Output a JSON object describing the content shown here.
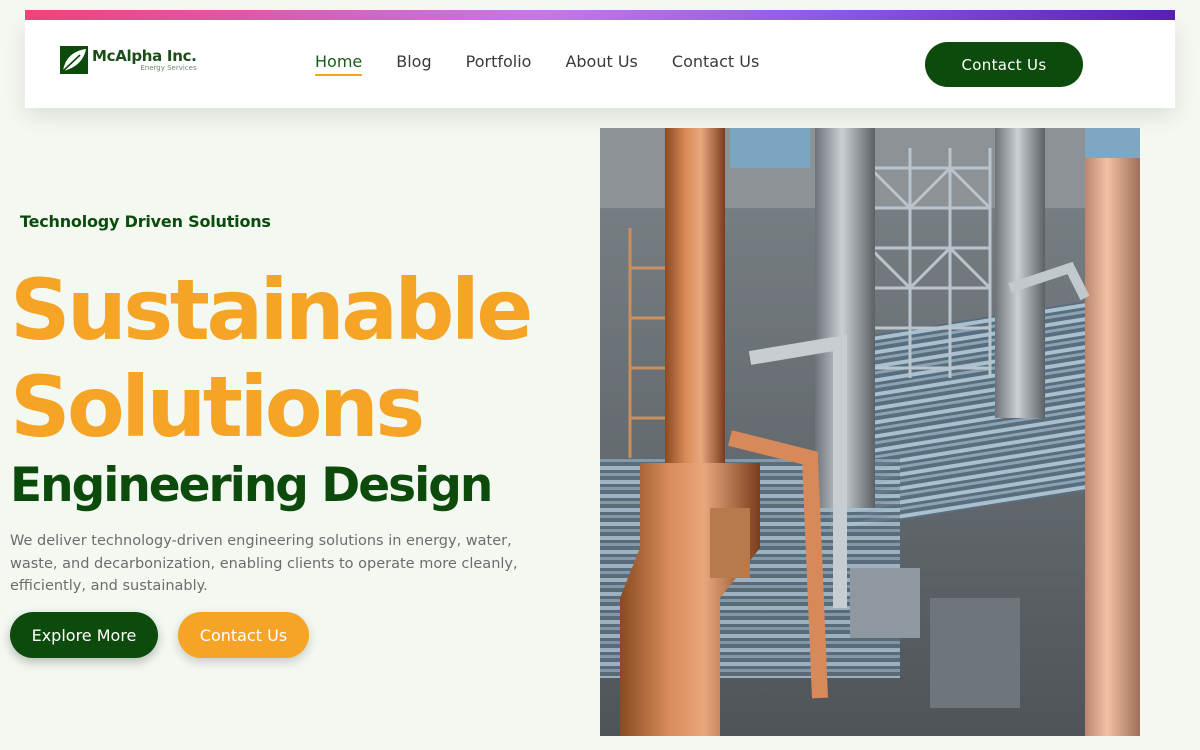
{
  "brand": {
    "name": "McAlpha Inc.",
    "subtitle": "Energy Services",
    "colors": {
      "primary_green": "#0c4b0c",
      "accent_orange": "#f5a425",
      "background": "#f3f8f1"
    }
  },
  "nav": {
    "items": [
      {
        "label": "Home",
        "active": true
      },
      {
        "label": "Blog",
        "active": false
      },
      {
        "label": "Portfolio",
        "active": false
      },
      {
        "label": "About Us",
        "active": false
      },
      {
        "label": "Contact Us",
        "active": false
      }
    ],
    "cta_label": "Contact Us"
  },
  "hero": {
    "tagline": "Technology Driven Solutions",
    "headline_line1": "Sustainable",
    "headline_line2": "Solutions",
    "subheadline": "Engineering Design",
    "description": "We deliver technology-driven engineering solutions in energy, water, waste, and decarbonization, enabling clients to operate more cleanly, efficiently, and sustainably.",
    "primary_button": "Explore More",
    "secondary_button": "Contact Us",
    "image_icon": "industrial-refinery-photo"
  }
}
